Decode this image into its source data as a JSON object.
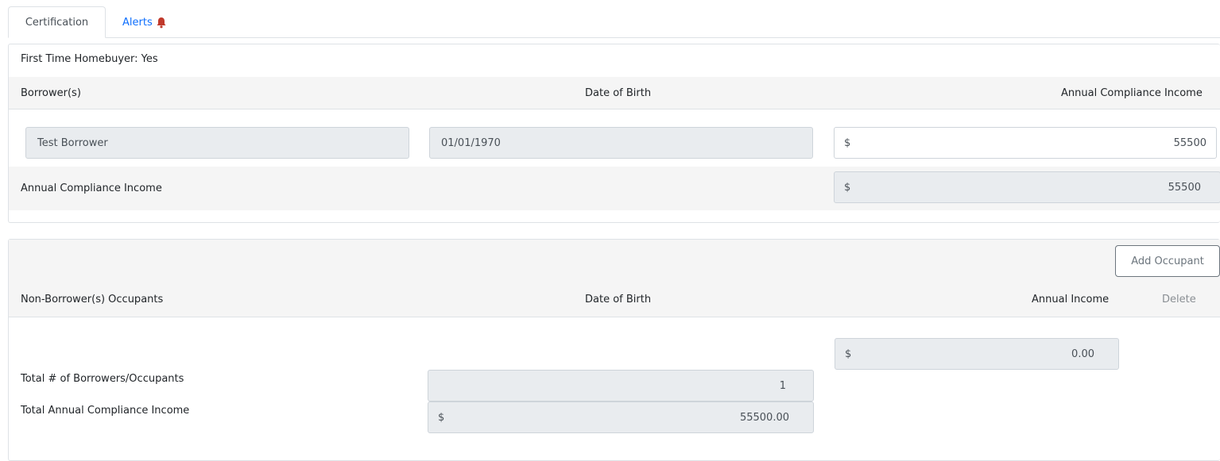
{
  "tabs": [
    {
      "label": "Certification"
    },
    {
      "label": "Alerts",
      "icon": "bell-icon",
      "icon_color": "#c0392b"
    }
  ],
  "borrowers": {
    "first_time_homebuyer": "First Time Homebuyer: Yes",
    "headers": {
      "borrower": "Borrower(s)",
      "dob": "Date of Birth",
      "income": "Annual Compliance Income"
    },
    "row": {
      "name": "Test Borrower",
      "dob": "01/01/1970",
      "currency": "$",
      "income": "55500"
    },
    "summary": {
      "label": "Annual Compliance Income",
      "currency": "$",
      "value": "55500"
    }
  },
  "occupants": {
    "add_button": "Add Occupant",
    "headers": {
      "occupants": "Non-Borrower(s) Occupants",
      "dob": "Date of Birth",
      "income": "Annual Income",
      "delete": "Delete"
    },
    "annual_income_total": {
      "currency": "$",
      "value": "0.00"
    },
    "total_count": {
      "label": "Total # of Borrowers/Occupants",
      "value": "1"
    },
    "total_income": {
      "label": "Total Annual Compliance Income",
      "currency": "$",
      "value": "55500.00"
    }
  },
  "colors": {
    "link": "#0d6efd",
    "alert": "#c0392b",
    "band": "#f5f5f5",
    "readonly": "#e9ecef"
  }
}
